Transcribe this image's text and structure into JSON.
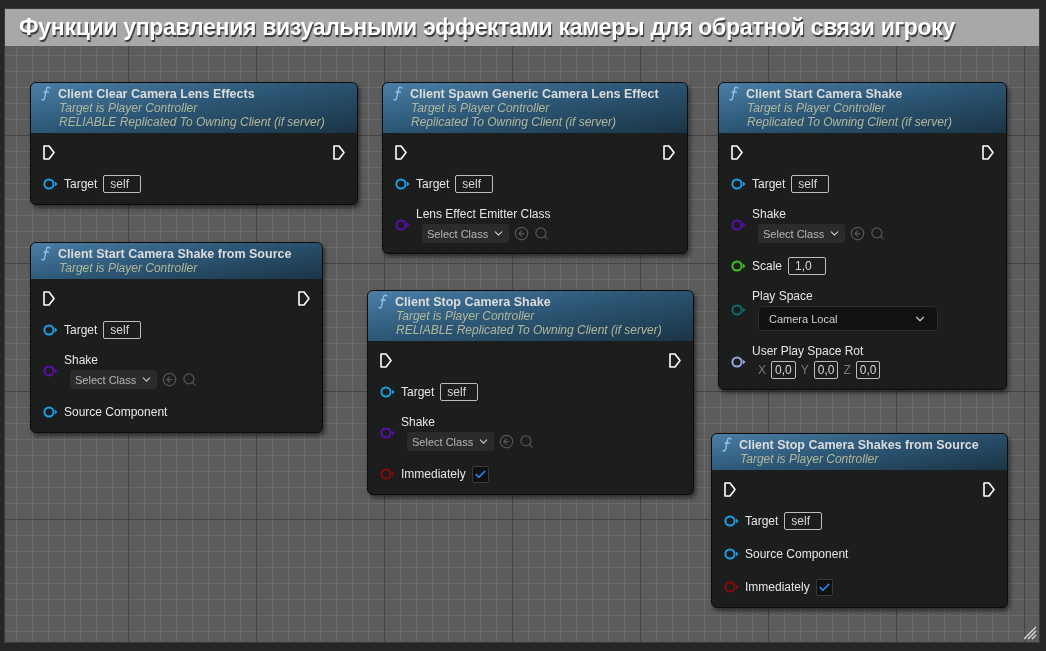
{
  "comment": {
    "title": "Функции управления визуальными эффектами камеры для обратной связи игроку"
  },
  "nodes": [
    {
      "title": "Client Clear Camera Lens Effects",
      "subtitle": [
        "Target is Player Controller",
        "RELIABLE Replicated To Owning Client (if server)"
      ],
      "pins": [
        {
          "kind": "object",
          "label": "Target",
          "value": "self",
          "color": "#1aa0e8"
        }
      ]
    },
    {
      "title": "Client Start Camera Shake from Source",
      "subtitle": [
        "Target is Player Controller"
      ],
      "pins": [
        {
          "kind": "object",
          "label": "Target",
          "value": "self",
          "color": "#1aa0e8"
        },
        {
          "kind": "class",
          "label": "Shake",
          "value": "Select Class",
          "color": "#5a10b0"
        },
        {
          "kind": "object",
          "label": "Source Component",
          "color": "#1aa0e8"
        }
      ]
    },
    {
      "title": "Client Spawn Generic Camera Lens Effect",
      "subtitle": [
        "Target is Player Controller",
        "Replicated To Owning Client (if server)"
      ],
      "pins": [
        {
          "kind": "object",
          "label": "Target",
          "value": "self",
          "color": "#1aa0e8"
        },
        {
          "kind": "class",
          "label": "Lens Effect Emitter Class",
          "value": "Select Class",
          "color": "#5a10b0"
        }
      ]
    },
    {
      "title": "Client Stop Camera Shake",
      "subtitle": [
        "Target is Player Controller",
        "RELIABLE Replicated To Owning Client (if server)"
      ],
      "pins": [
        {
          "kind": "object",
          "label": "Target",
          "value": "self",
          "color": "#1aa0e8"
        },
        {
          "kind": "class",
          "label": "Shake",
          "value": "Select Class",
          "color": "#5a10b0"
        },
        {
          "kind": "bool",
          "label": "Immediately",
          "checked": true,
          "color": "#8a0a0a"
        }
      ]
    },
    {
      "title": "Client Start Camera Shake",
      "subtitle": [
        "Target is Player Controller",
        "Replicated To Owning Client (if server)"
      ],
      "pins": [
        {
          "kind": "object",
          "label": "Target",
          "value": "self",
          "color": "#1aa0e8"
        },
        {
          "kind": "class",
          "label": "Shake",
          "value": "Select Class",
          "color": "#5a10b0"
        },
        {
          "kind": "float",
          "label": "Scale",
          "value": "1,0",
          "color": "#3cc41a"
        },
        {
          "kind": "enum",
          "label": "Play Space",
          "value": "Camera Local",
          "color": "#0e6b6b"
        },
        {
          "kind": "rotator",
          "label": "User Play Space Rot",
          "color": "#98a8e0",
          "axes": [
            {
              "axis": "X",
              "value": "0,0"
            },
            {
              "axis": "Y",
              "value": "0,0"
            },
            {
              "axis": "Z",
              "value": "0,0"
            }
          ]
        }
      ]
    },
    {
      "title": "Client Stop Camera Shakes from Source",
      "subtitle": [
        "Target is Player Controller"
      ],
      "pins": [
        {
          "kind": "object",
          "label": "Target",
          "value": "self",
          "color": "#1aa0e8"
        },
        {
          "kind": "object",
          "label": "Source Component",
          "color": "#1aa0e8"
        },
        {
          "kind": "bool",
          "label": "Immediately",
          "checked": true,
          "color": "#8a0a0a"
        }
      ]
    }
  ]
}
